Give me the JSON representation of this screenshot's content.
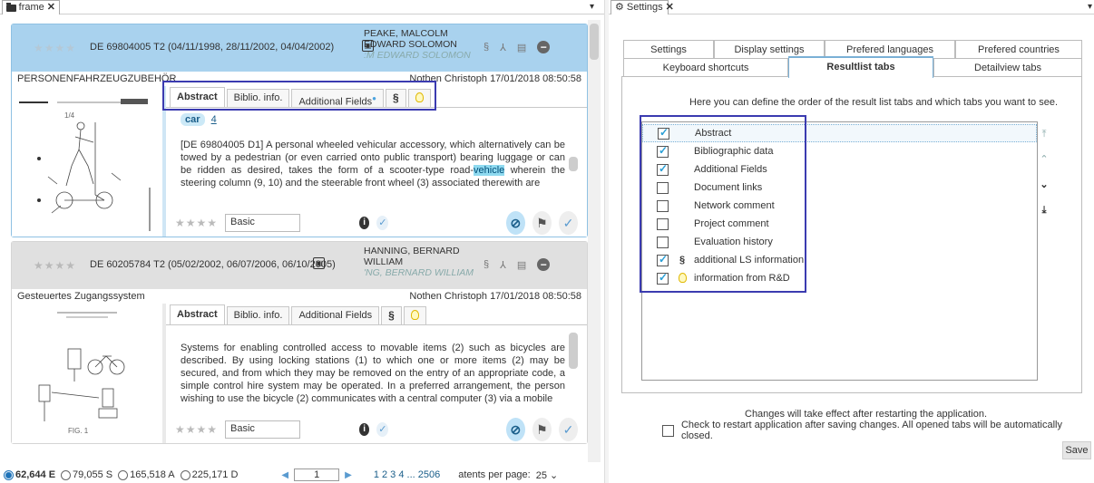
{
  "left_window": {
    "tab_label": "frame"
  },
  "results": [
    {
      "stars": "★★★★",
      "pubinfo": "DE 69804005 T2 (04/11/1998, 28/11/2002, 04/04/2002)",
      "names": [
        "PEAKE, MALCOLM",
        "EDWARD SOLOMON"
      ],
      "ghost_name": ":M EDWARD SOLOMON",
      "header_icons": [
        "§",
        "⅄",
        "▤"
      ],
      "title": "PERSONENFAHRZEUGZUBEHÖR",
      "meta": "Nothen Christoph 17/01/2018 08:50:58",
      "tabs": [
        "Abstract",
        "Biblio. info.",
        "Additional Fields"
      ],
      "keyword": "car",
      "keyword_count": "4",
      "abstract_pre": "[DE 69804005 D1] A personal wheeled vehicular accessory, which alternatively can be towed by a pedestrian (or even carried onto public transport) bearing luggage or can be ridden as desired, takes the form of a scooter-type road-",
      "abstract_hl": "vehicle",
      "abstract_post": " wherein the steering column (9, 10) and the steerable front wheel (3) associated therewith are",
      "rating_label": "Basic",
      "thumb_caption": "1/4"
    },
    {
      "stars": "★★★★",
      "pubinfo": "DE 60205784 T2 (05/02/2002, 06/07/2006, 06/10/2005)",
      "names": [
        "HANNING, BERNARD",
        "WILLIAM"
      ],
      "ghost_name": "'NG, BERNARD WILLIAM",
      "header_icons": [
        "§",
        "⅄",
        "▤"
      ],
      "title": "Gesteuertes Zugangssystem",
      "meta": "Nothen Christoph 17/01/2018 08:50:58",
      "tabs": [
        "Abstract",
        "Biblio. info.",
        "Additional Fields"
      ],
      "abstract": "Systems for enabling controlled access to movable items (2) such as bicycles are described. By using locking stations (1) to which one or more items (2) may be secured, and from which they may be removed on the entry of an appropriate code, a simple control hire system may be operated. In a preferred arrangement, the person wishing to use the bicycle (2) communicates with a central computer (3) via a mobile",
      "rating_label": "Basic",
      "thumb_caption": "FIG. 1"
    }
  ],
  "footer": {
    "counts": [
      "62,644 E",
      "79,055 S",
      "165,518 A",
      "225,171 D"
    ],
    "page_value": "1",
    "pages": "1 2 3 4 ... 2506",
    "per_page_label": "atents per page:",
    "per_page_value": "25"
  },
  "settings": {
    "tab_label": "Settings",
    "tabs_row1": [
      "Settings",
      "Display settings",
      "Prefered languages",
      "Prefered countries"
    ],
    "tabs_row2": [
      "Keyboard shortcuts",
      "Resultlist tabs",
      "Detailview tabs"
    ],
    "active_tab": "Resultlist tabs",
    "description": "Here you can define the order of the result list tabs and which tabs you want to see.",
    "items": [
      {
        "label": "Abstract",
        "checked": true,
        "icon": ""
      },
      {
        "label": "Bibliographic data",
        "checked": true,
        "icon": ""
      },
      {
        "label": "Additional Fields",
        "checked": true,
        "icon": ""
      },
      {
        "label": "Document links",
        "checked": false,
        "icon": ""
      },
      {
        "label": "Network comment",
        "checked": false,
        "icon": ""
      },
      {
        "label": "Project comment",
        "checked": false,
        "icon": ""
      },
      {
        "label": "Evaluation history",
        "checked": false,
        "icon": ""
      },
      {
        "label": "additional LS information",
        "checked": true,
        "icon": "§"
      },
      {
        "label": "information from R&D",
        "checked": true,
        "icon": "bulb"
      }
    ],
    "notice": "Changes will take effect after restarting the application.",
    "restart_label": "Check to restart application after saving changes. All opened tabs will be automatically closed.",
    "save_label": "Save"
  },
  "colors": {
    "accent": "#1e72b8",
    "highlight_frame": "#3b3bb0",
    "selected_card": "#cfe6f5"
  }
}
